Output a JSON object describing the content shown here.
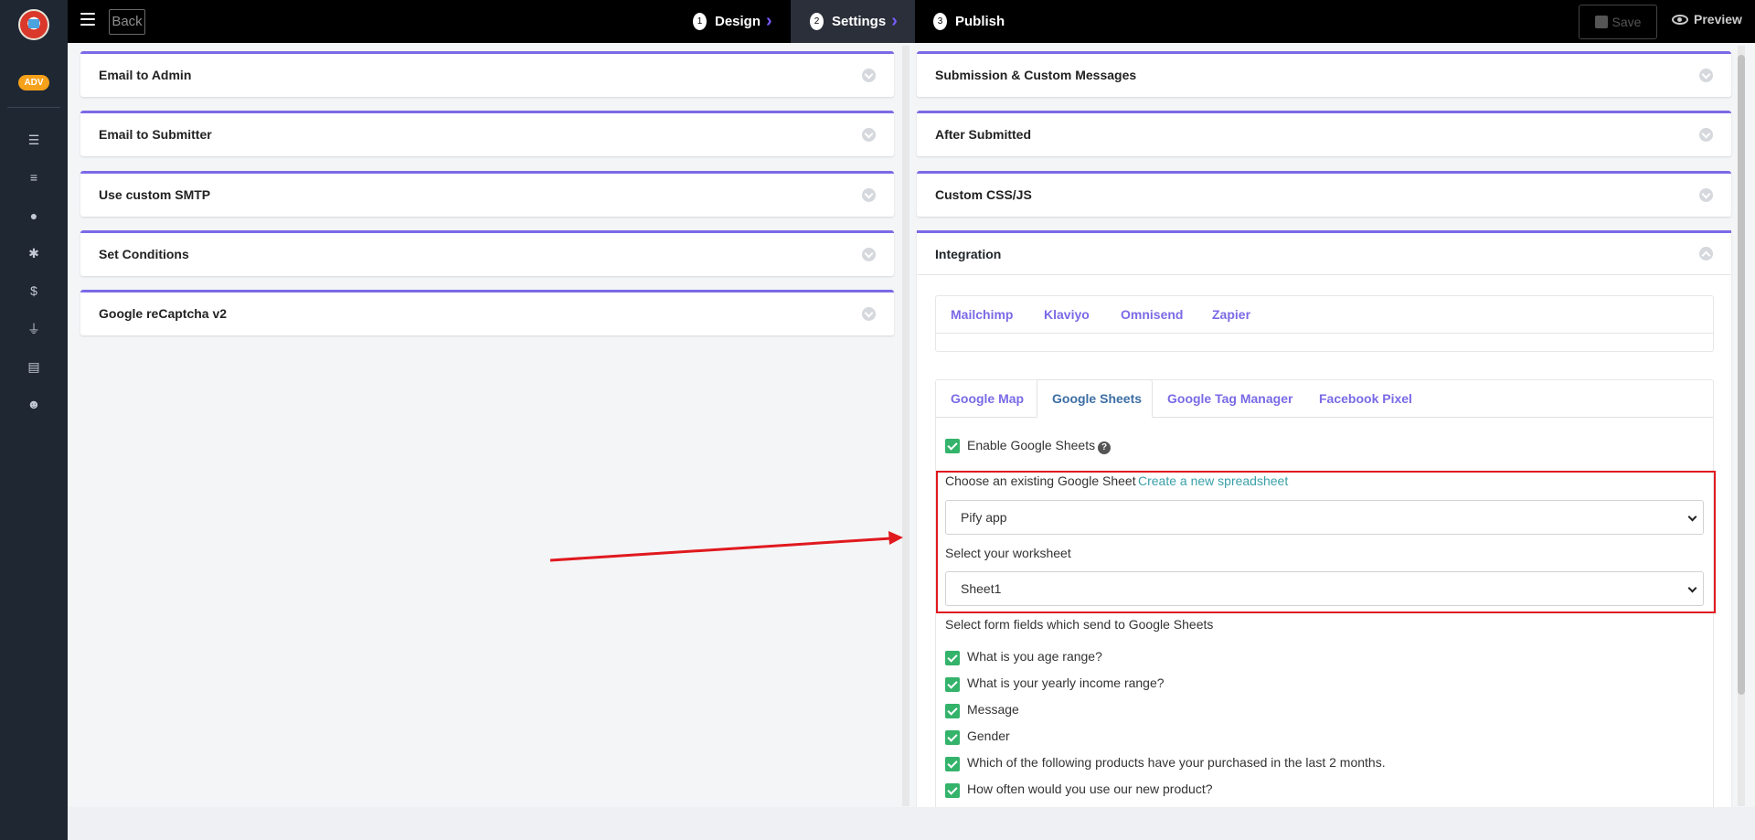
{
  "sidebar": {
    "badge": "ADV",
    "icons": [
      "list-icon",
      "checklist-icon",
      "user-icon",
      "gear-icon",
      "dollar-icon",
      "plug-icon",
      "file-icon",
      "smile-icon"
    ]
  },
  "topbar": {
    "back_label": "Back",
    "steps": [
      {
        "num": "1",
        "label": "Design"
      },
      {
        "num": "2",
        "label": "Settings"
      },
      {
        "num": "3",
        "label": "Publish"
      }
    ],
    "save_label": "Save",
    "preview_label": "Preview"
  },
  "left_panels": [
    "Email to Admin",
    "Email to Submitter",
    "Use custom SMTP",
    "Set Conditions",
    "Google reCaptcha v2"
  ],
  "right_panels": [
    "Submission & Custom Messages",
    "After Submitted",
    "Custom CSS/JS"
  ],
  "integration": {
    "title": "Integration",
    "tabs_top": [
      "Mailchimp",
      "Klaviyo",
      "Omnisend",
      "Zapier"
    ],
    "tabs_bottom": [
      "Google Map",
      "Google Sheets",
      "Google Tag Manager",
      "Facebook Pixel"
    ],
    "enable_label": "Enable Google Sheets",
    "choose_label": "Choose an existing Google Sheet",
    "create_link": "Create a new spreadsheet",
    "sheet_value": "Pify app",
    "worksheet_label": "Select your worksheet",
    "worksheet_value": "Sheet1",
    "fields_label": "Select form fields which send to Google Sheets",
    "fields": [
      "What is you age range?",
      "What is your yearly income range?",
      "Message",
      "Gender",
      "Which of the following products have your purchased in the last 2 months.",
      "How often would you use our new product?"
    ]
  },
  "colors": {
    "accent": "#7a6ae6",
    "check": "#34b36b",
    "highlight": "#e0191e",
    "link": "#3aa0a9"
  }
}
